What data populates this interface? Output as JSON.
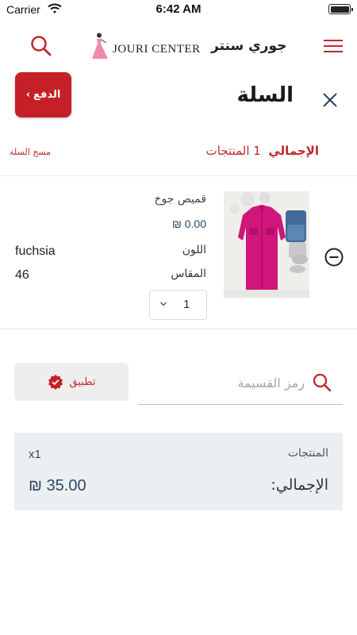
{
  "status_bar": {
    "carrier": "Carrier",
    "time": "6:42 AM"
  },
  "header": {
    "logo_en": "JOURI CENTER",
    "logo_ar": "جوري سنتر"
  },
  "cart": {
    "title": "السلة",
    "checkout_label": "الدفع",
    "clear_label": "مسح السلة",
    "total_items_label": "الإجمالي",
    "total_items_count": "1",
    "total_items_suffix": "المنتجات"
  },
  "item": {
    "name": "قميص جوخ",
    "price": "₪ 0.00",
    "color_label": "اللون",
    "color_value": "fuchsia",
    "size_label": "المقاس",
    "size_value": "46",
    "quantity": "1"
  },
  "coupon": {
    "placeholder": "رمز القسيمة",
    "apply_label": "تطبيق"
  },
  "totals": {
    "items_label": "المنتجات",
    "items_value": "x1",
    "total_label": "الإجمالي:",
    "total_value": "₪ 35.00"
  },
  "colors": {
    "accent": "#c51f27",
    "price": "#2d4a66",
    "product": "#d0157b"
  },
  "icons": {
    "search": "search-icon",
    "menu": "menu-icon",
    "close": "close-icon",
    "remove": "minus-circle-icon",
    "apply": "verified-badge-icon",
    "dropdown": "chevron-down-icon"
  }
}
